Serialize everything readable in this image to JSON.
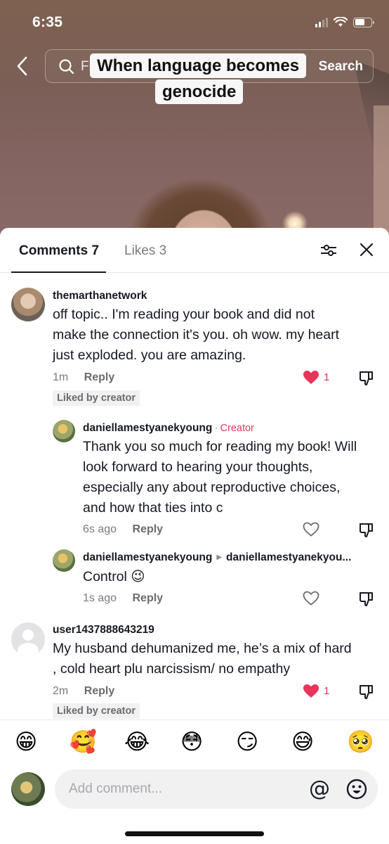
{
  "status_bar": {
    "time": "6:35"
  },
  "search": {
    "placeholder_visible": "Fi",
    "button_label": "Search"
  },
  "video": {
    "caption_line1": "When language becomes",
    "caption_line2": "genocide"
  },
  "sheet": {
    "tabs": [
      {
        "label": "Comments 7",
        "active": true
      },
      {
        "label": "Likes 3",
        "active": false
      }
    ],
    "icons": {
      "filter": "sliders-icon",
      "close": "close-icon"
    }
  },
  "comments": [
    {
      "username": "themarthanetwork",
      "text_lines": [
        "off topic.. I'm reading your book and did not",
        "make the connection it's you. oh wow. my heart",
        "just exploded. you are amazing."
      ],
      "time": "1m",
      "reply_label": "Reply",
      "likes": "1",
      "liked": true,
      "badge": "Liked by creator"
    },
    {
      "username": "daniellamestyanekyoung",
      "separator": "·",
      "creator_tag": "Creator",
      "text_lines": [
        "Thank you so much for reading my book! Will",
        "look forward to hearing your thoughts,",
        "especially any about reproductive choices,",
        "and how that ties into c"
      ],
      "time": "6s ago",
      "reply_label": "Reply",
      "liked": false
    },
    {
      "username": "daniellamestyanekyoung",
      "reply_to": "daniellamestyanekyou...",
      "text": "Control 😉",
      "time": "1s ago",
      "reply_label": "Reply",
      "liked": false
    },
    {
      "username": "user1437888643219",
      "text_lines": [
        "My husband dehumanized me, he’s a mix of hard",
        ", cold heart plu narcissism/ no empathy"
      ],
      "time": "2m",
      "reply_label": "Reply",
      "likes": "1",
      "liked": true,
      "badge": "Liked by creator"
    }
  ],
  "quick_emojis": [
    "😁",
    "🥰",
    "😂",
    "😳",
    "😏",
    "😅",
    "🥺"
  ],
  "composer": {
    "placeholder": "Add comment...",
    "mention_label": "@"
  },
  "colors": {
    "accent_red": "#e8355a",
    "creator_tag": "#e0395f",
    "text_primary": "#161823",
    "text_secondary": "#7a7b80"
  }
}
